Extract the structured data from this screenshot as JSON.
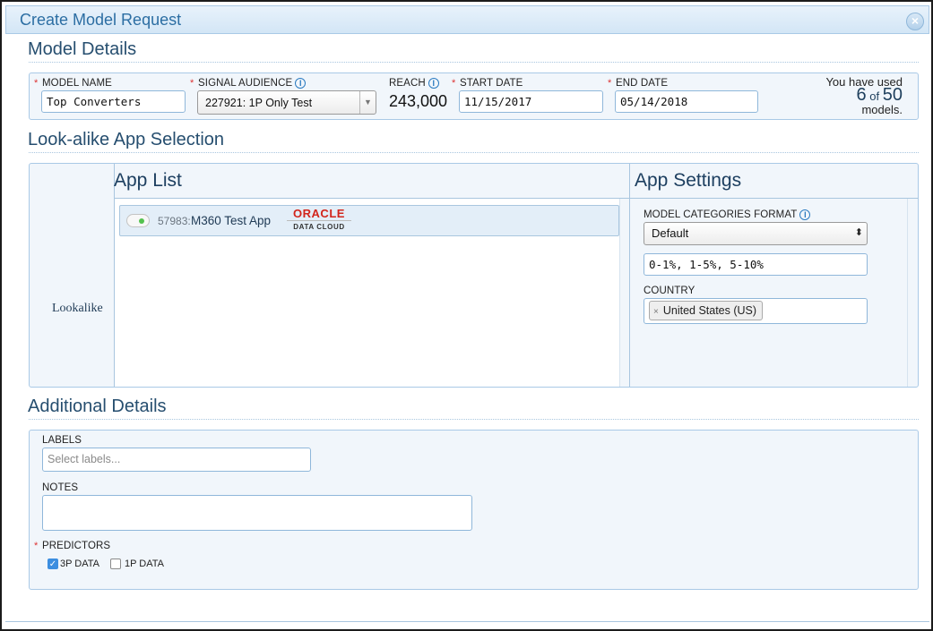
{
  "dialog": {
    "title": "Create Model Request",
    "close_glyph": "×"
  },
  "model_details": {
    "heading": "Model Details",
    "model_name_label": "MODEL NAME",
    "model_name_value": "Top Converters",
    "signal_audience_label": "SIGNAL AUDIENCE",
    "signal_audience_value": "227921: 1P Only Test",
    "reach_label": "REACH",
    "reach_value": "243,000",
    "start_date_label": "START DATE",
    "start_date_value": "11/15/2017",
    "end_date_label": "END DATE",
    "end_date_value": "05/14/2018",
    "usage_line1": "You have used",
    "usage_used": "6",
    "usage_of": "of",
    "usage_total": "50",
    "usage_line3": "models."
  },
  "lookalike": {
    "heading": "Look-alike App Selection",
    "row_label": "Lookalike",
    "app_list_heading": "App List",
    "apps": [
      {
        "id": "57983:",
        "name": "M360 Test App",
        "provider_top": "ORACLE",
        "provider_bottom": "DATA CLOUD",
        "enabled": true
      }
    ],
    "settings_heading": "App Settings",
    "categories_format_label": "MODEL CATEGORIES FORMAT",
    "categories_format_value": "Default",
    "categories_value": "0-1%, 1-5%, 5-10%",
    "country_label": "COUNTRY",
    "country_tags": [
      "United States (US)"
    ],
    "tag_remove_glyph": "×"
  },
  "additional": {
    "heading": "Additional Details",
    "labels_label": "LABELS",
    "labels_placeholder": "Select labels...",
    "notes_label": "NOTES",
    "notes_value": "",
    "predictors_label": "PREDICTORS",
    "predictors": [
      {
        "label": "3P DATA",
        "checked": true
      },
      {
        "label": "1P DATA",
        "checked": false
      }
    ]
  },
  "required_marker": "*",
  "info_glyph": "i",
  "check_glyph": "✓",
  "select_arrow": "▼",
  "select_updown": "⬍"
}
